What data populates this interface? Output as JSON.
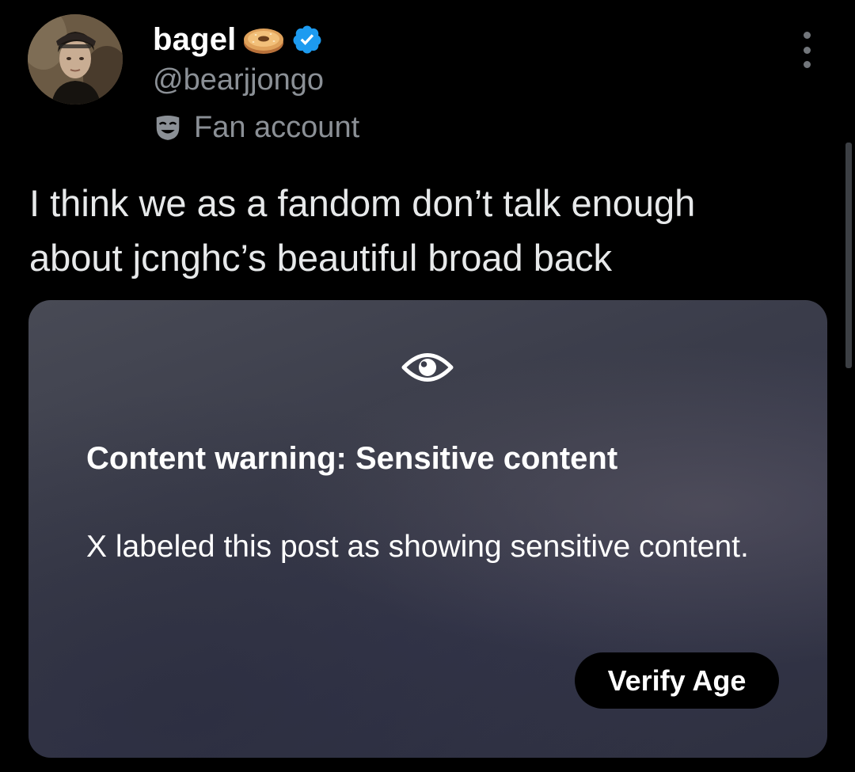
{
  "author": {
    "display_name": "bagel",
    "emoji_icon": "bagel-emoji",
    "verified_icon": "verified-badge-icon",
    "handle": "@bearjjongo",
    "affiliation_icon": "theater-mask-icon",
    "affiliation_label": "Fan account"
  },
  "menu": {
    "icon": "more-options-icon"
  },
  "post": {
    "text": "I think we as a fandom don’t talk enough\nabout jcnghc’s beautiful broad back"
  },
  "media_warning": {
    "icon": "eye-icon",
    "title": "Content warning: Sensitive content",
    "body": "X labeled this post as showing sensitive content.",
    "button_label": "Verify Age"
  },
  "colors": {
    "background": "#000000",
    "text_primary": "#e7e9ea",
    "text_secondary": "#8b9096",
    "verified_blue": "#1d9bf0",
    "card_bg": "#3a3c4a"
  }
}
